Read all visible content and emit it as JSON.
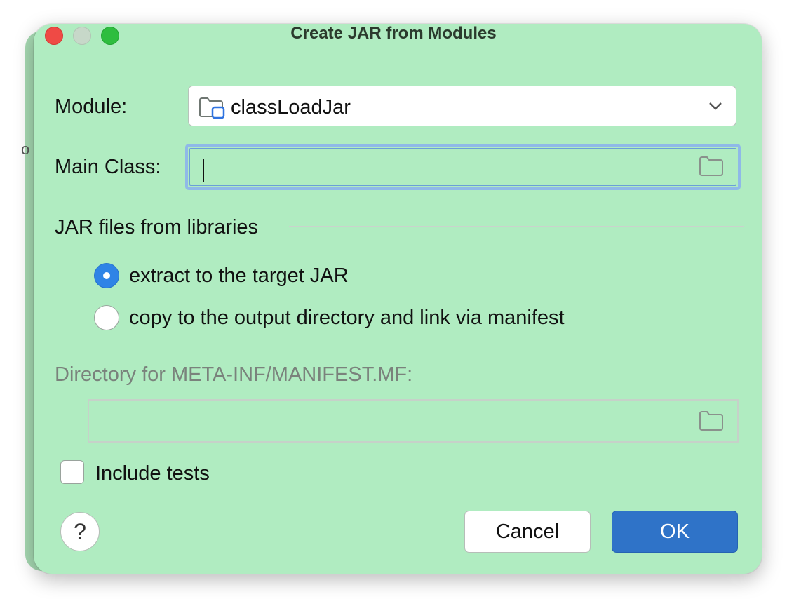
{
  "window": {
    "title": "Create JAR from Modules"
  },
  "background_peek_text": "o",
  "module": {
    "label": "Module:",
    "value": "classLoadJar"
  },
  "main_class": {
    "label": "Main Class:",
    "value": ""
  },
  "section": {
    "title": "JAR files from libraries"
  },
  "radios": [
    {
      "label": "extract to the target JAR",
      "selected": true
    },
    {
      "label": "copy to the output directory and link via manifest",
      "selected": false
    }
  ],
  "manifest_dir": {
    "label": "Directory for META-INF/MANIFEST.MF:",
    "value": ""
  },
  "include_tests": {
    "label": "Include tests",
    "checked": false
  },
  "buttons": {
    "help": "?",
    "cancel": "Cancel",
    "ok": "OK"
  },
  "colors": {
    "dialog_bg": "#b0ecc1",
    "accent": "#2f73c8",
    "radio_selected": "#2f84e6",
    "disabled_text": "#7a827c"
  },
  "icons": {
    "module": "module-folder-icon",
    "dropdown": "chevron-down-icon",
    "browse": "folder-icon"
  }
}
